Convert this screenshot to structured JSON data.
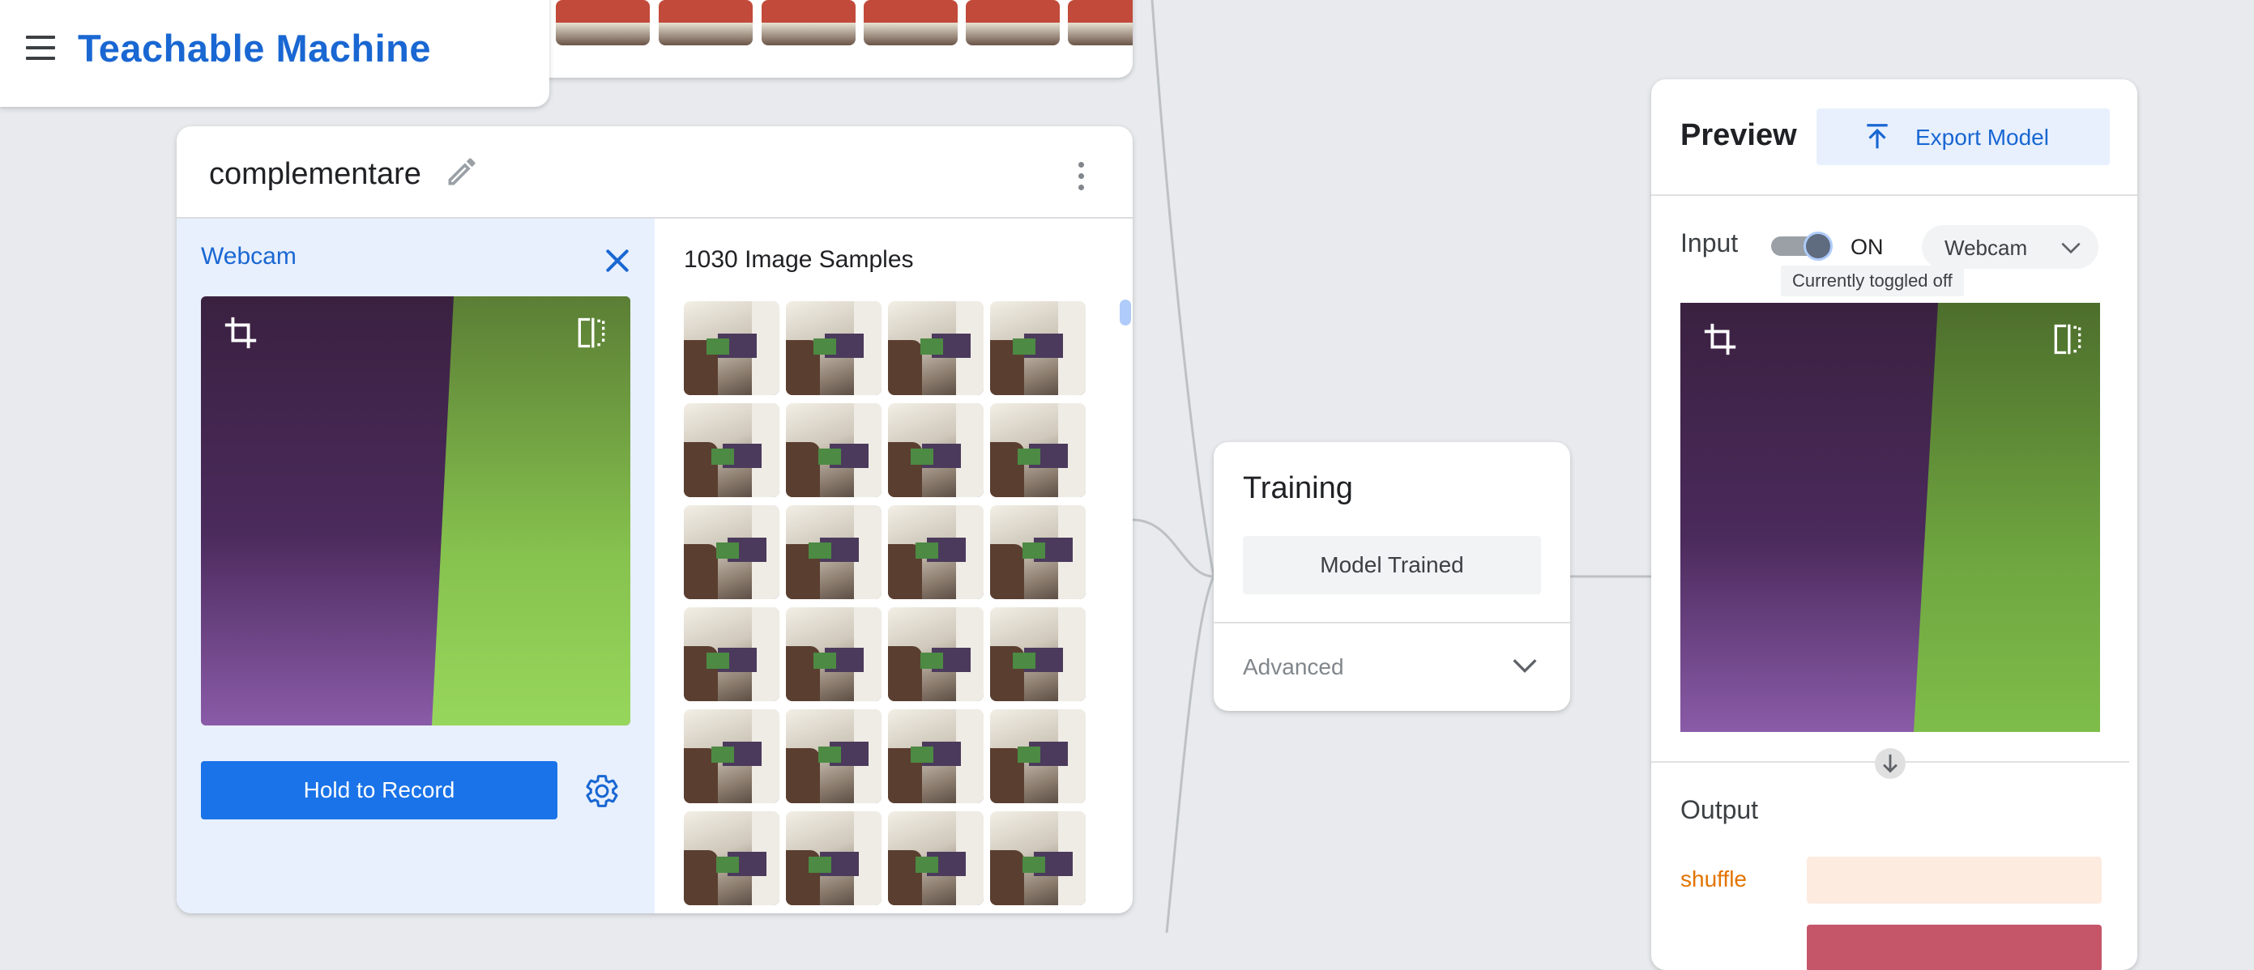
{
  "app": {
    "title": "Teachable Machine"
  },
  "class_card": {
    "name": "complementare",
    "webcam_label": "Webcam",
    "record_label": "Hold to Record",
    "samples_title": "1030 Image Samples"
  },
  "training": {
    "title": "Training",
    "status_button": "Model Trained",
    "advanced_label": "Advanced"
  },
  "preview": {
    "title": "Preview",
    "export_label": "Export Model",
    "input_label": "Input",
    "toggle_state": "ON",
    "source": "Webcam",
    "tooltip": "Currently toggled off",
    "output_label": "Output",
    "outputs": [
      {
        "label": "shuffle",
        "color": "#e37400",
        "bar_color": "#fdebe0"
      },
      {
        "label": "",
        "color": "#c5566a",
        "bar_color": "#c5566a"
      }
    ]
  },
  "colors": {
    "accent": "#1967d2",
    "primary_button": "#1a73e8",
    "webcam_panel_bg": "#e8f0fe",
    "canvas_bg": "#e8eaed"
  },
  "icons": [
    "menu-icon",
    "pencil-icon",
    "more-vert-icon",
    "close-icon",
    "crop-icon",
    "flip-icon",
    "settings-icon",
    "chevron-down-icon",
    "export-icon",
    "arrow-down-icon"
  ]
}
